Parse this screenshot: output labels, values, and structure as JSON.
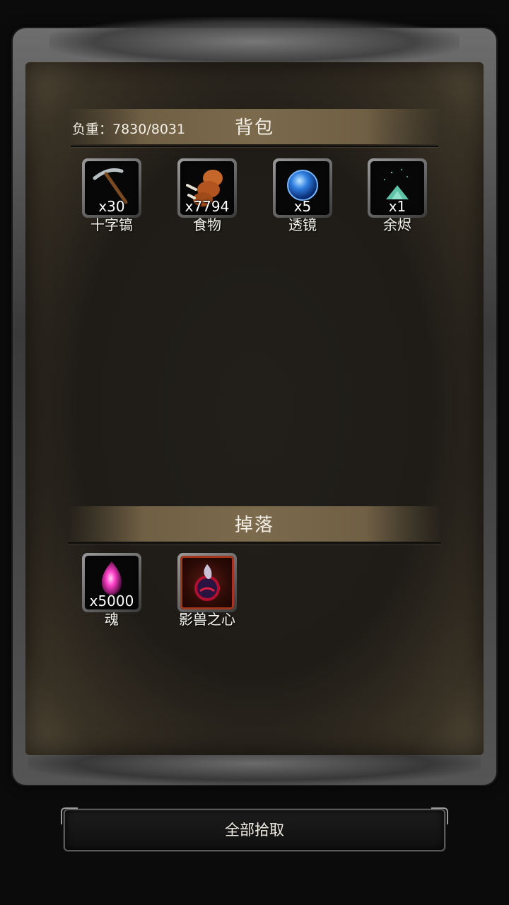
{
  "backpack": {
    "title": "背包",
    "weight_label": "负重：7830/8031",
    "items": [
      {
        "name": "十字镐",
        "qty": "x30",
        "icon": "pickaxe-icon"
      },
      {
        "name": "食物",
        "qty": "x7794",
        "icon": "meat-icon"
      },
      {
        "name": "透镜",
        "qty": "x5",
        "icon": "blue-orb-icon"
      },
      {
        "name": "余烬",
        "qty": "x1",
        "icon": "ember-pile-icon"
      }
    ]
  },
  "drops": {
    "title": "掉落",
    "items": [
      {
        "name": "魂",
        "qty": "x5000",
        "icon": "pink-soul-icon"
      },
      {
        "name": "影兽之心",
        "qty": "",
        "icon": "shadow-beast-heart-icon"
      }
    ]
  },
  "actions": {
    "pickup_all_label": "全部拾取"
  },
  "colors": {
    "panel_bg": "#1f1c17",
    "section_bar": "#7b6a4c",
    "highlight_slot": "#a0361d"
  }
}
